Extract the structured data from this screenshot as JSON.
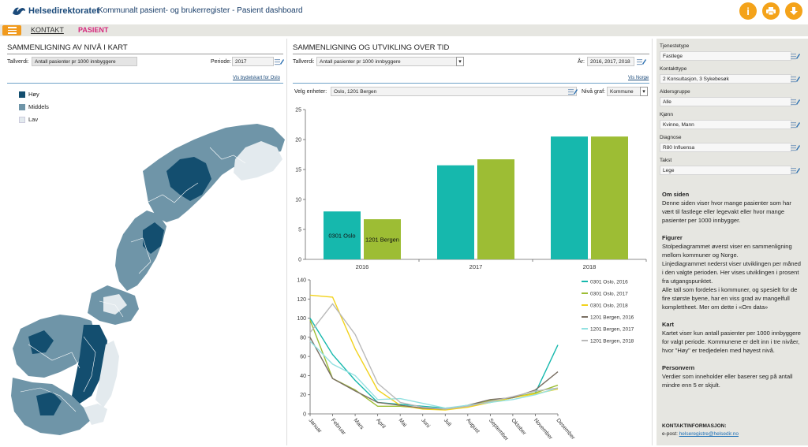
{
  "header": {
    "logo_text": "Helsedirektoratet",
    "title": "Kommunalt pasient- og brukerregister - Pasient dashboard",
    "info_icon": "info-icon",
    "print_icon": "print-icon",
    "download_icon": "download-icon",
    "accent": "#f4a31a"
  },
  "nav": {
    "kontakt": "KONTAKT",
    "pasient": "PASIENT"
  },
  "map_panel": {
    "title": "SAMMENLIGNING AV NIVÅ I KART",
    "tallverdi_label": "Tallverdi:",
    "tallverdi_value": "Antall pasienter pr 1000 innbyggere",
    "periode_label": "Periode:",
    "periode_value": "2017",
    "link": "Vis bydelskart for Oslo",
    "legend": [
      {
        "label": "Høy",
        "color": "#134e6f"
      },
      {
        "label": "Middels",
        "color": "#6f95a8"
      },
      {
        "label": "Lav",
        "color": "#e3eaee"
      }
    ]
  },
  "dev_panel": {
    "title": "SAMMENLIGNING OG UTVIKLING OVER TID",
    "tallverdi_label": "Tallverdi:",
    "tallverdi_value": "Antall pasienter pr 1000 innbyggere",
    "aar_label": "År:",
    "aar_value": "2016, 2017, 2018",
    "link": "Vis Norge",
    "enheter_label": "Velg enheter:",
    "enheter_value": "Oslo, 1201 Bergen",
    "niva_label": "Nivå graf:",
    "niva_value": "Kommune"
  },
  "filters": [
    {
      "label": "Tjenestetype",
      "value": "Fastlege"
    },
    {
      "label": "Kontakttype",
      "value": "2 Konsultasjon, 3 Sykebesøk"
    },
    {
      "label": "Aldersgruppe",
      "value": "Alle"
    },
    {
      "label": "Kjønn",
      "value": "Kvinne, Mann"
    },
    {
      "label": "Diagnose",
      "value": "R80 Influensa"
    },
    {
      "label": "Takst",
      "value": "Lege"
    }
  ],
  "info": {
    "om_title": "Om siden",
    "om_text": "Denne siden viser hvor mange pasienter som har vært til fastlege eller legevakt eller hvor mange pasienter per 1000 innbygger.",
    "fig_title": "Figurer",
    "fig_text1": "Stolpediagrammet øverst viser en sammenligning mellom kommuner og Norge.",
    "fig_text2": "Linjediagrammet nederst viser utviklingen per måned i den valgte perioden. Her vises utviklingen i prosent fra utgangspunktet.",
    "fig_text3": "Alle tall som fordeles i kommuner, og spesielt for de fire største byene, har en viss grad av mangelfull komplettheet. Mer om dette i «Om data»",
    "kart_title": "Kart",
    "kart_text": "Kartet viser kun antall pasienter per 1000 innbyggere for valgt periode. Kommunene er delt inn i tre nivåer, hvor \"Høy\" er tredjedelen med høyest nivå.",
    "pers_title": "Personvern",
    "pers_text": "Verdier som inneholder eller baserer seg på antall mindre enn 5 er skjult.",
    "contact_title": "KONTAKTINFORMASJON:",
    "contact_label": "e-post:",
    "contact_email": "helseregistre@helsedir.no"
  },
  "chart_data": [
    {
      "type": "bar",
      "categories": [
        "2016",
        "2017",
        "2018"
      ],
      "series": [
        {
          "name": "0301 Oslo",
          "values": [
            8,
            15.7,
            20.5
          ],
          "color": "#16b8ad"
        },
        {
          "name": "1201 Bergen",
          "values": [
            6.7,
            16.7,
            20.5
          ],
          "color": "#9dbd34"
        }
      ],
      "ylim": [
        0,
        25
      ],
      "yticks": [
        0,
        5,
        10,
        15,
        20,
        25
      ],
      "bar_labels": {
        "series0_cat0": "0301 Oslo",
        "series1_cat0": "1201 Bergen"
      },
      "grid": false
    },
    {
      "type": "line",
      "x": [
        "Januar",
        "Februar",
        "Mars",
        "April",
        "Mai",
        "Juni",
        "Juli",
        "August",
        "September",
        "Oktober",
        "November",
        "Desember"
      ],
      "ylim": [
        0,
        140
      ],
      "yticks": [
        0,
        20,
        40,
        60,
        80,
        100,
        120,
        140
      ],
      "legend_position": "right",
      "series": [
        {
          "name": "0301 Oslo, 2016",
          "color": "#16b8ad",
          "values": [
            100,
            62,
            35,
            12,
            10,
            8,
            6,
            8,
            12,
            17,
            22,
            72
          ]
        },
        {
          "name": "0301 Oslo, 2017",
          "color": "#9dbd34",
          "values": [
            98,
            37,
            25,
            8,
            8,
            6,
            5,
            8,
            14,
            17,
            22,
            30
          ]
        },
        {
          "name": "0301 Oslo, 2018",
          "color": "#f2d21c",
          "values": [
            124,
            122,
            68,
            25,
            9,
            5,
            4,
            7,
            12,
            17,
            21,
            26
          ]
        },
        {
          "name": "1201 Bergen, 2016",
          "color": "#7a6f63",
          "values": [
            80,
            37,
            24,
            12,
            9,
            6,
            5,
            9,
            15,
            17,
            25,
            44
          ]
        },
        {
          "name": "1201 Bergen, 2017",
          "color": "#93e1e1",
          "values": [
            76,
            52,
            40,
            15,
            16,
            11,
            6,
            9,
            12,
            15,
            20,
            27
          ]
        },
        {
          "name": "1201 Bergen, 2018",
          "color": "#b9b9b9",
          "values": [
            85,
            115,
            83,
            32,
            12,
            7,
            5,
            8,
            13,
            18,
            24,
            27
          ]
        }
      ]
    }
  ]
}
